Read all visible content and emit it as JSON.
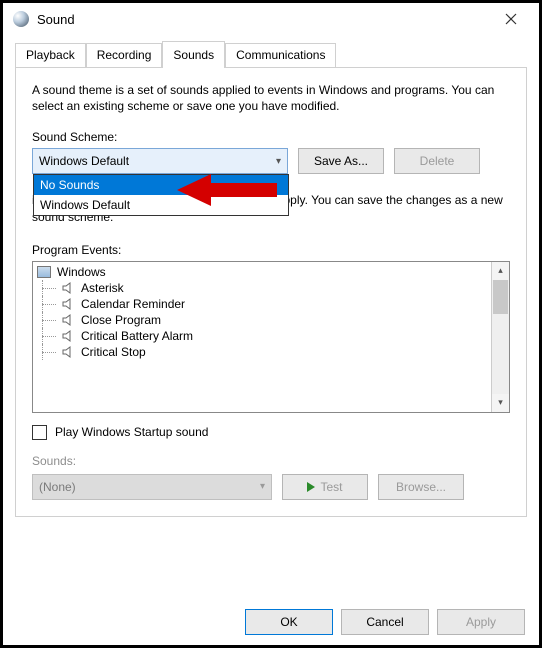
{
  "titlebar": {
    "title": "Sound"
  },
  "tabs": {
    "items": [
      {
        "label": "Playback"
      },
      {
        "label": "Recording"
      },
      {
        "label": "Sounds"
      },
      {
        "label": "Communications"
      }
    ]
  },
  "panel": {
    "description": "A sound theme is a set of sounds applied to events in Windows and programs.  You can select an existing scheme or save one you have modified.",
    "scheme_label": "Sound Scheme:",
    "scheme_value": "Windows Default",
    "scheme_options": [
      {
        "label": "No Sounds"
      },
      {
        "label": "Windows Default"
      }
    ],
    "save_as": "Save As...",
    "delete": "Delete",
    "partial_visible_text": "in the following list and then select a sound to apply.  You can save the changes as a new sound scheme.",
    "events_label": "Program Events:",
    "events_root": "Windows",
    "events": [
      "Asterisk",
      "Calendar Reminder",
      "Close Program",
      "Critical Battery Alarm",
      "Critical Stop"
    ],
    "startup_checkbox": "Play Windows Startup sound",
    "sounds_label": "Sounds:",
    "sounds_value": "(None)",
    "test": "Test",
    "browse": "Browse..."
  },
  "footer": {
    "ok": "OK",
    "cancel": "Cancel",
    "apply": "Apply"
  }
}
